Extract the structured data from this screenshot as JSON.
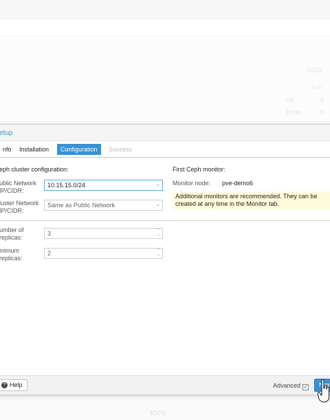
{
  "background": {
    "osds_header": "OSDs",
    "in_label": "In",
    "in_value": "0",
    "up_label": "Up",
    "up_value": "0",
    "down_label": "Down",
    "down_value": "0",
    "iops_label": "IOPS:"
  },
  "dialog": {
    "title": "etup",
    "tabs": [
      {
        "label": "nfo",
        "state": "normal"
      },
      {
        "label": "Installation",
        "state": "normal"
      },
      {
        "label": "Configuration",
        "state": "active"
      },
      {
        "label": "Success",
        "state": "disabled"
      }
    ],
    "left_section_title": "eph cluster configuration:",
    "public_network": {
      "label": "ublic Network\nIP/CIDR:",
      "value": "10.15.15.0/24"
    },
    "cluster_network": {
      "label": "luster Network\nIP/CIDR:",
      "value": "Same as Public Network"
    },
    "replicas": {
      "label": "umber of\nreplicas:",
      "value": "3"
    },
    "min_replicas": {
      "label": "inimum\nreplicas:",
      "value": "2"
    },
    "right_section_title": "First Ceph monitor:",
    "monitor_node": {
      "label": "Monitor node:",
      "value": "pve-demo6"
    },
    "info_text": "Additional monitors are recommended. They can be created at any time in the Monitor tab.",
    "footer": {
      "help_label": "Help",
      "advanced_label": "Advanced",
      "advanced_checked": true,
      "next_label": "Next"
    }
  },
  "colors": {
    "accent": "#3892d4",
    "info_bg": "#fdfbdc"
  }
}
